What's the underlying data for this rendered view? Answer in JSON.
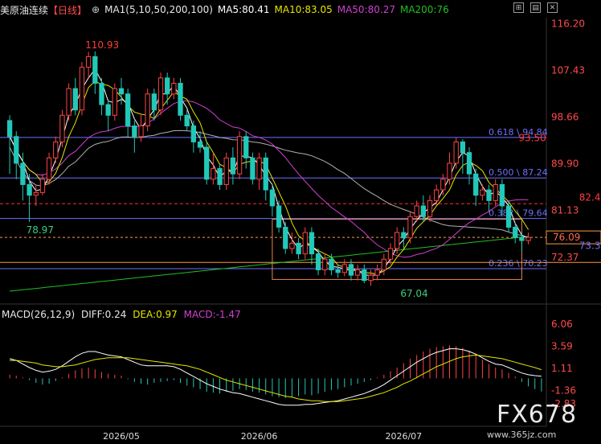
{
  "header": {
    "title": "美原油连续",
    "period": "【日线】",
    "ma_params": "MA1(5,10,50,200,100)",
    "ma5": "MA5:80.41",
    "ma10": "MA10:83.05",
    "ma50": "MA50:80.27",
    "ma200": "MA200:76"
  },
  "macd_header": {
    "params": "MACD(26,12,9)",
    "diff": "DIFF:0.24",
    "dea": "DEA:0.97",
    "macd": "MACD:-1.47"
  },
  "watermark": {
    "brand": "FX678",
    "url": "www.365jz.com"
  },
  "icons": [
    "expand-icon",
    "chart-icon",
    "close-icon"
  ],
  "colors": {
    "up": "#ff4444",
    "down": "#22c8b8",
    "ma5": "#ffffff",
    "ma10": "#e6e600",
    "ma50": "#d040d0",
    "ma200": "#20c020",
    "ma100": "#b0b0b0",
    "fib": "#7070ff",
    "box": "#e88848",
    "price_label": "#ff3c3c",
    "low_label": "#39d07a",
    "current_line": "#ff9a40",
    "axis_text": "#ff4a4a"
  },
  "chart_data": {
    "type": "candlestick",
    "title": "美原油连续",
    "ylim": [
      66,
      117
    ],
    "y_ticks": [
      "116.20",
      "107.43",
      "98.66",
      "89.90",
      "81.13",
      "72.37"
    ],
    "x_ticks": [
      "2026/05",
      "2026/06",
      "2026/07"
    ],
    "annotations": [
      {
        "label": "110.93",
        "x": 12,
        "y": 110.93
      },
      {
        "label": "78.97",
        "x": 3,
        "y": 78.97
      },
      {
        "label": "67.04",
        "x": 60,
        "y": 67.04
      },
      {
        "label": "93.50",
        "x": 78,
        "y": 93.5
      },
      {
        "label": "82.40",
        "x": 86,
        "y": 82.4
      },
      {
        "label": "73.30",
        "x": 86,
        "y": 73.3
      }
    ],
    "fib_levels": [
      {
        "label": "0.618 \\ 94.84",
        "value": 94.84
      },
      {
        "label": "0.500 \\ 87.24",
        "value": 87.24
      },
      {
        "label": "0.382 \\ 79.64",
        "value": 79.64
      },
      {
        "label": "0.236 \\ 70.23",
        "value": 70.23
      }
    ],
    "current_price": "76.09",
    "current_value": 76.09,
    "resistance": 82.4,
    "box": {
      "x_start": 40,
      "x_end": 78,
      "y_top": 79.5,
      "y_bottom": 68.2
    },
    "candles": [
      [
        98,
        95,
        99,
        88
      ],
      [
        95,
        90,
        96,
        87
      ],
      [
        90,
        86,
        92,
        83
      ],
      [
        86,
        84,
        88,
        79
      ],
      [
        84,
        84.5,
        86,
        82
      ],
      [
        84.5,
        87,
        88,
        84
      ],
      [
        87,
        91,
        92,
        86
      ],
      [
        91,
        94,
        95,
        90
      ],
      [
        94,
        99,
        100,
        93
      ],
      [
        99,
        104,
        105,
        98
      ],
      [
        104,
        100,
        106,
        99
      ],
      [
        100,
        108,
        109,
        99
      ],
      [
        108,
        110,
        110.9,
        106
      ],
      [
        110,
        105,
        111,
        103
      ],
      [
        105,
        101,
        106,
        99
      ],
      [
        101,
        99,
        102,
        96
      ],
      [
        99,
        104,
        105,
        98
      ],
      [
        104,
        103,
        106,
        101
      ],
      [
        103,
        97,
        104,
        95
      ],
      [
        97,
        95,
        98,
        92
      ],
      [
        95,
        97,
        99,
        94
      ],
      [
        97,
        103,
        104,
        96
      ],
      [
        103,
        100,
        104,
        98
      ],
      [
        100,
        106,
        107,
        99
      ],
      [
        106,
        103,
        107,
        101
      ],
      [
        103,
        105,
        106,
        102
      ],
      [
        105,
        99,
        106,
        98
      ],
      [
        99,
        97,
        100,
        96
      ],
      [
        97,
        94,
        98,
        92
      ],
      [
        94,
        93,
        96,
        92
      ],
      [
        93,
        87,
        94,
        86
      ],
      [
        87,
        89,
        92,
        86
      ],
      [
        89,
        86,
        90,
        85
      ],
      [
        86,
        91,
        92,
        85
      ],
      [
        91,
        88,
        93,
        86
      ],
      [
        88,
        95,
        96,
        87
      ],
      [
        95,
        91,
        96,
        89
      ],
      [
        91,
        87,
        92,
        86
      ],
      [
        87,
        91,
        92,
        85
      ],
      [
        91,
        85,
        92,
        83
      ],
      [
        85,
        82,
        86,
        80
      ],
      [
        82,
        78,
        83,
        77
      ],
      [
        78,
        74,
        79,
        73
      ],
      [
        74,
        75,
        77,
        73
      ],
      [
        75,
        73,
        76,
        72
      ],
      [
        73,
        77,
        78,
        72
      ],
      [
        77,
        73,
        78,
        71
      ],
      [
        73,
        70,
        74,
        69
      ],
      [
        70,
        72,
        73,
        69
      ],
      [
        72,
        70,
        73,
        69
      ],
      [
        70,
        69.5,
        71,
        68.5
      ],
      [
        69.5,
        71,
        72,
        68.8
      ],
      [
        71,
        69,
        72,
        68
      ],
      [
        69,
        70,
        71,
        68
      ],
      [
        70,
        68,
        71,
        67.5
      ],
      [
        68,
        69,
        70,
        67
      ],
      [
        69,
        70,
        71,
        68
      ],
      [
        70,
        72,
        73,
        69
      ],
      [
        72,
        74,
        75,
        71
      ],
      [
        74,
        77,
        78,
        73
      ],
      [
        77,
        76,
        78,
        74
      ],
      [
        76,
        80,
        81,
        75
      ],
      [
        80,
        82,
        83,
        79
      ],
      [
        82,
        80,
        84,
        79
      ],
      [
        80,
        83,
        84,
        79
      ],
      [
        83,
        85,
        86,
        82
      ],
      [
        85,
        87,
        88,
        84
      ],
      [
        87,
        90,
        92,
        86
      ],
      [
        90,
        94,
        94.8,
        89
      ],
      [
        94,
        92,
        94.5,
        88
      ],
      [
        92,
        88,
        93,
        86
      ],
      [
        88,
        84,
        89,
        82
      ],
      [
        84,
        85,
        86,
        83
      ],
      [
        85,
        83,
        86,
        81
      ],
      [
        83,
        86,
        87,
        82
      ],
      [
        86,
        82,
        87,
        80
      ],
      [
        82,
        78,
        83,
        77
      ],
      [
        78,
        76.1,
        79,
        75
      ],
      [
        76.1,
        75.5,
        77,
        73.3
      ],
      [
        75.5,
        76.09,
        77,
        74.8
      ]
    ],
    "macd_ylim": [
      -3.2,
      6.5
    ],
    "macd_ticks": [
      "6.06",
      "3.59",
      "1.11",
      "-1.36",
      "-2.83"
    ],
    "macd_hist": [
      0.4,
      0.3,
      0.1,
      -0.2,
      -0.5,
      -0.7,
      -0.6,
      -0.3,
      0.1,
      0.5,
      0.9,
      1.1,
      1.2,
      1.0,
      0.7,
      0.5,
      0.4,
      0.3,
      -0.1,
      -0.4,
      -0.6,
      -0.7,
      -0.5,
      -0.4,
      -0.3,
      -0.2,
      -0.5,
      -0.8,
      -1.0,
      -1.2,
      -1.5,
      -1.6,
      -1.7,
      -1.5,
      -1.4,
      -1.2,
      -1.3,
      -1.5,
      -1.6,
      -1.8,
      -2.0,
      -2.1,
      -2.2,
      -2.1,
      -2.0,
      -1.8,
      -1.9,
      -1.7,
      -1.5,
      -1.3,
      -1.2,
      -1.0,
      -0.8,
      -0.6,
      -0.4,
      -0.2,
      0.1,
      0.4,
      0.8,
      1.2,
      1.7,
      2.2,
      2.6,
      3.0,
      3.3,
      3.5,
      3.6,
      3.7,
      3.6,
      3.4,
      3.1,
      2.6,
      2.1,
      1.6,
      1.2,
      1.0,
      0.6,
      0.2,
      -0.4,
      -0.9,
      -1.2,
      -1.47
    ],
    "diff": [
      2.2,
      2.0,
      1.6,
      1.2,
      0.9,
      0.7,
      0.8,
      1.0,
      1.4,
      1.9,
      2.4,
      2.8,
      3.0,
      3.0,
      2.8,
      2.6,
      2.5,
      2.4,
      2.1,
      1.8,
      1.5,
      1.4,
      1.4,
      1.4,
      1.4,
      1.3,
      1.0,
      0.6,
      0.2,
      -0.2,
      -0.6,
      -0.9,
      -1.2,
      -1.4,
      -1.6,
      -1.7,
      -1.9,
      -2.1,
      -2.3,
      -2.5,
      -2.7,
      -2.9,
      -3.0,
      -3.0,
      -3.0,
      -2.9,
      -2.9,
      -2.8,
      -2.7,
      -2.6,
      -2.5,
      -2.3,
      -2.1,
      -1.9,
      -1.7,
      -1.4,
      -1.1,
      -0.7,
      -0.2,
      0.3,
      0.8,
      1.3,
      1.8,
      2.2,
      2.6,
      2.9,
      3.1,
      3.3,
      3.3,
      3.2,
      3.0,
      2.7,
      2.3,
      1.9,
      1.6,
      1.5,
      1.2,
      0.9,
      0.6,
      0.4,
      0.3,
      0.24
    ],
    "dea": [
      2.0,
      2.0,
      1.9,
      1.8,
      1.7,
      1.5,
      1.4,
      1.3,
      1.3,
      1.4,
      1.5,
      1.7,
      1.9,
      2.1,
      2.2,
      2.3,
      2.3,
      2.3,
      2.3,
      2.2,
      2.1,
      2.0,
      1.9,
      1.8,
      1.7,
      1.6,
      1.5,
      1.4,
      1.2,
      1.0,
      0.7,
      0.4,
      0.1,
      -0.2,
      -0.4,
      -0.6,
      -0.8,
      -1.0,
      -1.2,
      -1.4,
      -1.6,
      -1.8,
      -2.0,
      -2.1,
      -2.3,
      -2.4,
      -2.5,
      -2.5,
      -2.6,
      -2.6,
      -2.6,
      -2.5,
      -2.4,
      -2.3,
      -2.2,
      -2.0,
      -1.8,
      -1.6,
      -1.3,
      -1.0,
      -0.6,
      -0.3,
      0.1,
      0.5,
      0.9,
      1.3,
      1.6,
      1.9,
      2.2,
      2.4,
      2.5,
      2.6,
      2.5,
      2.4,
      2.3,
      2.2,
      2.0,
      1.8,
      1.6,
      1.4,
      1.2,
      0.97
    ]
  }
}
